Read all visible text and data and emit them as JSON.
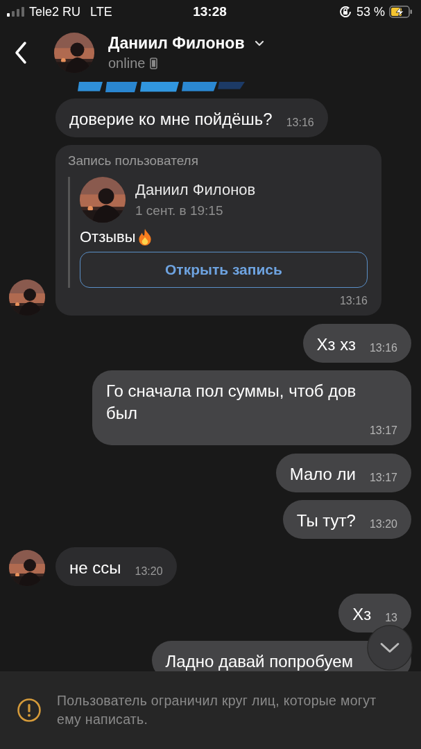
{
  "status_bar": {
    "carrier": "Tele2 RU",
    "network": "LTE",
    "time": "13:28",
    "battery": "53 %"
  },
  "header": {
    "name": "Даниил Филонов",
    "status": "online"
  },
  "messages": [
    {
      "kind": "incoming",
      "avatar": false,
      "text": "доверие ко мне пойдёшь?",
      "time": "13:16"
    },
    {
      "kind": "post",
      "avatar": true,
      "label": "Запись пользователя",
      "author": "Даниил Филонов",
      "date": "1 сент. в 19:15",
      "text": "Отзывы",
      "button": "Открыть запись",
      "time": "13:16"
    },
    {
      "kind": "outgoing",
      "text": "Хз хз",
      "time": "13:16"
    },
    {
      "kind": "outgoing",
      "text": "Го сначала пол суммы, чтоб дов был",
      "time": "13:17"
    },
    {
      "kind": "outgoing",
      "text": "Мало ли",
      "time": "13:17"
    },
    {
      "kind": "outgoing",
      "text": "Ты тут?",
      "time": "13:20"
    },
    {
      "kind": "incoming",
      "avatar": true,
      "text": "не ссы",
      "time": "13:20"
    },
    {
      "kind": "outgoing",
      "text": "Хз",
      "time": "13"
    },
    {
      "kind": "outgoing",
      "text": "Ладно давай попробуем"
    }
  ],
  "notice": {
    "text": "Пользователь ограничил круг лиц, которые могут ему написать."
  }
}
